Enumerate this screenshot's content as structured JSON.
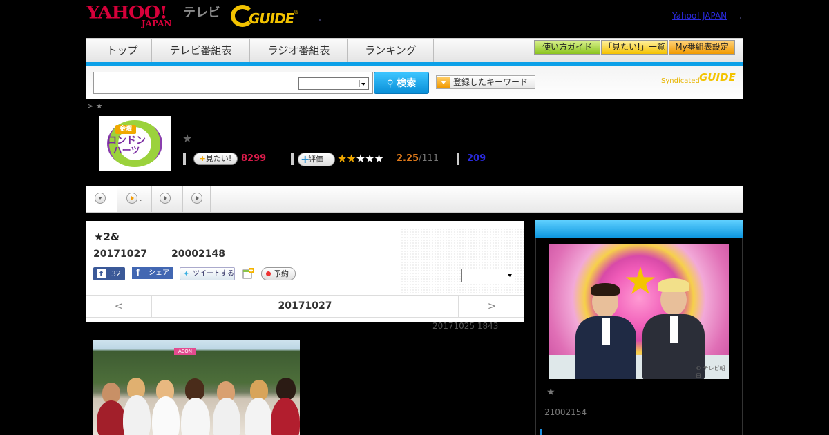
{
  "header": {
    "logo_yahoo_main": "YAHOO!",
    "logo_yahoo_sub": "JAPAN",
    "logo_tv": "テレビ",
    "logo_gguide": "GUIDE",
    "logo_gguide_reg": "®",
    "yahoo_japan_link": "Yahoo! JAPAN"
  },
  "nav": {
    "tabs": [
      "トップ",
      "テレビ番組表",
      "ラジオ番組表",
      "ランキング"
    ],
    "guide_button": "使い方ガイド",
    "mitai_list_button": "「見たい!」一覧",
    "my_schedule_button": "My番組表設定"
  },
  "search": {
    "placeholder": "",
    "button": "検索",
    "keyword_button": "登録したキーワード",
    "syndicated": "Syndicated",
    "syndicated_logo": "GUIDE"
  },
  "breadcrumb": "> ★",
  "program": {
    "badge_top": "金曜",
    "badge_mid": "ロンドン",
    "badge_bot": "ハーツ",
    "title_star": "★",
    "mitai_button": "見たい!",
    "mitai_count": "8299",
    "hyoka_button": "評価",
    "stars_on": "★★",
    "stars_off": "★★★",
    "rating": "2.25",
    "rating_total": "/111",
    "review_count": "209"
  },
  "subnav": {
    "item2_suffix": "."
  },
  "episode": {
    "title": "★2&",
    "date": "20171027",
    "time": "20002148",
    "fb_count": "32",
    "fb_share": "シェア",
    "tweet": "ツイートする",
    "reserve": "予約",
    "pager_prev": "<",
    "pager_date": "20171027",
    "pager_next": ">",
    "updated": "20171025  1843"
  },
  "photo": {
    "banner": "AEON"
  },
  "sidebar": {
    "image_copyright": "© テレビ朝日",
    "star": "★",
    "time": "21002154"
  },
  "colors": {
    "accent_blue": "#0ca0e8",
    "yahoo_red": "#d7003a",
    "gguide_yellow": "#f3c300",
    "mitai_pink": "#d81b4a",
    "rating_orange": "#e07a1a",
    "link_blue": "#2a2adc"
  }
}
